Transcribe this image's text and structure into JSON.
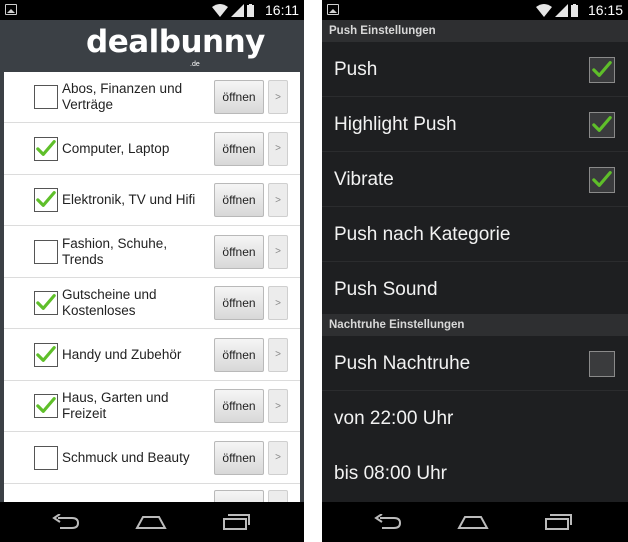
{
  "left": {
    "status_time": "16:11",
    "logo": "dealbunny",
    "logo_domain": ".de",
    "open_label": "öffnen",
    "arrow_label": ">",
    "categories": [
      {
        "label": "Abos, Finanzen und Verträge",
        "checked": false
      },
      {
        "label": "Computer, Laptop",
        "checked": true
      },
      {
        "label": "Elektronik, TV und Hifi",
        "checked": true
      },
      {
        "label": "Fashion, Schuhe, Trends",
        "checked": false
      },
      {
        "label": "Gutscheine und Kostenloses",
        "checked": true
      },
      {
        "label": "Handy und Zubehör",
        "checked": true
      },
      {
        "label": "Haus, Garten und Freizeit",
        "checked": true
      },
      {
        "label": "Schmuck und Beauty",
        "checked": false
      }
    ]
  },
  "right": {
    "status_time": "16:15",
    "push_section": "Push Einstellungen",
    "push": {
      "label": "Push",
      "checked": true
    },
    "highlight_push": {
      "label": "Highlight Push",
      "checked": true
    },
    "vibrate": {
      "label": "Vibrate",
      "checked": true
    },
    "push_category": {
      "label": "Push nach Kategorie"
    },
    "push_sound": {
      "label": "Push Sound"
    },
    "night_section": "Nachtruhe Einstellungen",
    "push_nachtruhe": {
      "label": "Push Nachtruhe",
      "checked": false
    },
    "from_time": {
      "label": "von 22:00 Uhr"
    },
    "to_time": {
      "label": "bis 08:00 Uhr"
    }
  },
  "colors": {
    "check_green": "#5fbf2a",
    "header_bg": "#3b4045",
    "dark_bg": "#1e1f21"
  }
}
